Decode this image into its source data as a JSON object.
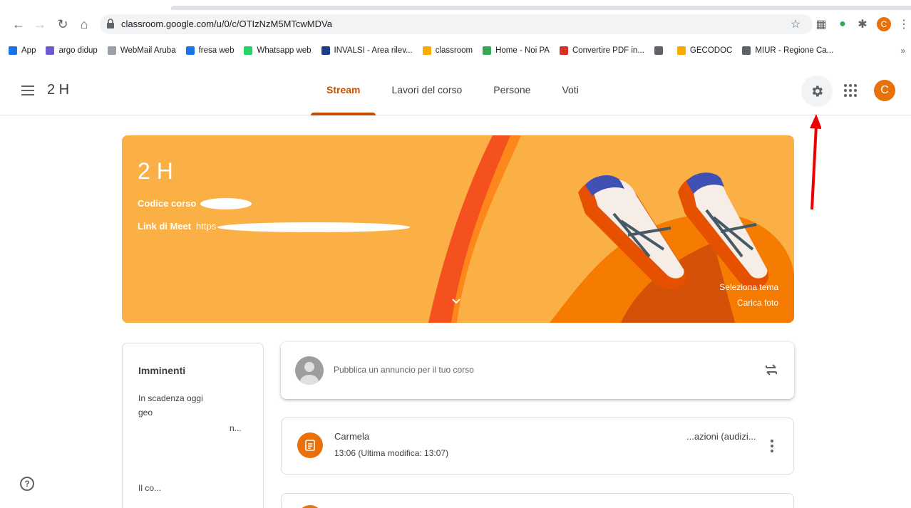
{
  "browser": {
    "url": "classroom.google.com/u/0/c/OTIzNzM5MTcwMDVa",
    "profile_initial": "C",
    "bookmarks": [
      {
        "label": "App",
        "color": "#1a73e8"
      },
      {
        "label": "argo didup",
        "color": "#6d5bd0"
      },
      {
        "label": "WebMail Aruba",
        "color": "#9aa0a6"
      },
      {
        "label": "fresa web",
        "color": "#1a73e8"
      },
      {
        "label": "Whatsapp web",
        "color": "#25d366"
      },
      {
        "label": "INVALSI - Area rilev...",
        "color": "#1f3c88"
      },
      {
        "label": "classroom",
        "color": "#f9ab00"
      },
      {
        "label": "Home - Noi PA",
        "color": "#34a853"
      },
      {
        "label": "Convertire PDF in...",
        "color": "#d93025"
      },
      {
        "label": "",
        "color": "#5f6368"
      },
      {
        "label": "GECODOC",
        "color": "#f9ab00"
      },
      {
        "label": "MIUR - Regione Ca...",
        "color": "#5f6368"
      }
    ],
    "more_bookmarks": "»"
  },
  "header": {
    "class_name": "2 H",
    "tabs": [
      "Stream",
      "Lavori del corso",
      "Persone",
      "Voti"
    ],
    "active_tab": 0,
    "avatar_initial": "C",
    "accent": "#c65102"
  },
  "banner": {
    "title": "2 H",
    "course_code_label": "Codice corso",
    "meet_link_label": "Link di Meet",
    "meet_link_prefix": "https",
    "select_theme": "Seleziona tema",
    "upload_photo": "Carica foto",
    "bg_color": "#fbb045"
  },
  "upcoming": {
    "title": "Imminenti",
    "due_today": "In scadenza oggi",
    "item1": "geo",
    "item2": "n...",
    "footer": "Il co..."
  },
  "stream": {
    "announce_placeholder": "Pubblica un annuncio per il tuo corso",
    "post_title_start": "Carmela",
    "post_title_end": "...azioni (audizi...",
    "post_time": "13:06 (Ultima modifica: 13:07)"
  }
}
